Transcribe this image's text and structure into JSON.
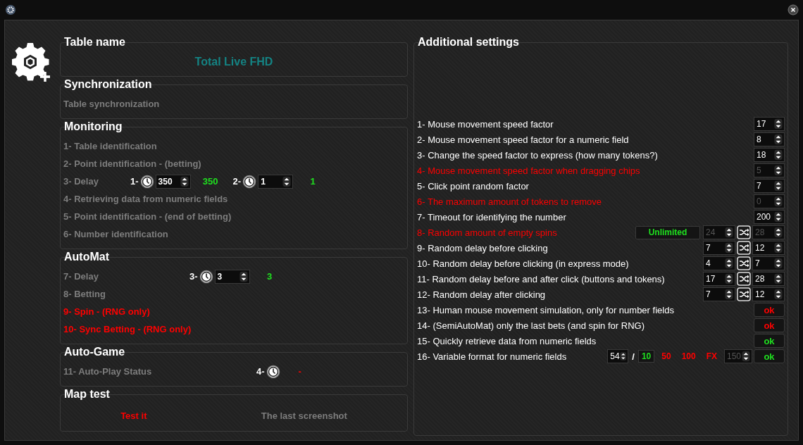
{
  "table_name": {
    "title": "Table name",
    "value": "Total Live FHD"
  },
  "synchronization": {
    "title": "Synchronization",
    "items": [
      {
        "label": "Table synchronization",
        "alert": false
      }
    ]
  },
  "monitoring": {
    "title": "Monitoring",
    "items": [
      {
        "label": "1- Table identification",
        "alert": false
      },
      {
        "label": "2- Point identification - (betting)",
        "alert": false
      },
      {
        "label": "3- Delay",
        "alert": false,
        "timers": [
          {
            "label": "1-",
            "value": "350",
            "reading": "350",
            "alert": false
          },
          {
            "label": "2-",
            "value": "1",
            "reading": "1",
            "alert": false
          }
        ]
      },
      {
        "label": "4- Retrieving data from numeric fields",
        "alert": false
      },
      {
        "label": "5- Point identification - (end of betting)",
        "alert": false
      },
      {
        "label": "6- Number identification",
        "alert": false
      }
    ]
  },
  "automat": {
    "title": "AutoMat",
    "items": [
      {
        "label": "7- Delay",
        "alert": false,
        "timers": [
          {
            "label": "3-",
            "value": "3",
            "reading": "3",
            "alert": false
          }
        ]
      },
      {
        "label": "8- Betting",
        "alert": false
      },
      {
        "label": "9- Spin - (RNG only)",
        "alert": true
      },
      {
        "label": "10- Sync Betting - (RNG only)",
        "alert": true
      }
    ]
  },
  "auto_game": {
    "title": "Auto-Game",
    "items": [
      {
        "label": "11- Auto-Play Status",
        "alert": false,
        "timers": [
          {
            "label": "4-",
            "reading": "-",
            "alert": true
          }
        ]
      }
    ]
  },
  "map_test": {
    "title": "Map test",
    "links": [
      {
        "label": "Test it",
        "alert": true
      },
      {
        "label": "The last screenshot",
        "alert": false
      }
    ]
  },
  "additional_settings": {
    "title": "Additional settings",
    "rows": [
      {
        "kind": "spin",
        "label": "1- Mouse movement speed factor",
        "alert": false,
        "value": "17",
        "disabled": false
      },
      {
        "kind": "spin",
        "label": "2- Mouse movement speed factor for a numeric field",
        "alert": false,
        "value": "8",
        "disabled": false
      },
      {
        "kind": "spin",
        "label": "3- Change the speed factor to express (how many tokens?)",
        "alert": false,
        "value": "18",
        "disabled": false
      },
      {
        "kind": "spin",
        "label": "4- Mouse movement speed factor when dragging chips",
        "alert": true,
        "value": "5",
        "disabled": true
      },
      {
        "kind": "spin",
        "label": "5- Click point random factor",
        "alert": false,
        "value": "7",
        "disabled": false
      },
      {
        "kind": "spin",
        "label": "6- The maximum amount of tokens to remove",
        "alert": true,
        "value": "0",
        "disabled": true
      },
      {
        "kind": "spin",
        "label": "7- Timeout for identifying the number",
        "alert": false,
        "value": "200",
        "disabled": false
      },
      {
        "kind": "range",
        "label": "8- Random amount of empty spins",
        "alert": true,
        "button": "Unlimited",
        "min": "24",
        "max": "28",
        "disabled": true
      },
      {
        "kind": "range",
        "label": "9- Random delay before clicking",
        "alert": false,
        "min": "7",
        "max": "12",
        "disabled": false
      },
      {
        "kind": "range",
        "label": "10- Random delay before clicking (in express mode)",
        "alert": false,
        "min": "4",
        "max": "7",
        "disabled": false
      },
      {
        "kind": "range",
        "label": "11- Random delay before and after click (buttons and tokens)",
        "alert": false,
        "min": "17",
        "max": "28",
        "disabled": false
      },
      {
        "kind": "range",
        "label": "12- Random delay after clicking",
        "alert": false,
        "min": "7",
        "max": "12",
        "disabled": false
      },
      {
        "kind": "toggle",
        "label": "13- Human mouse movement simulation, only for number fields",
        "alert": false,
        "button": "ok",
        "on": false
      },
      {
        "kind": "toggle",
        "label": "14- (SemiAutoMat) only the last bets (and spin for RNG)",
        "alert": false,
        "button": "ok",
        "on": false
      },
      {
        "kind": "toggle",
        "label": "15- Quickly retrieve data from numeric fields",
        "alert": false,
        "button": "ok",
        "on": true
      },
      {
        "kind": "format",
        "label": "16- Variable format for numeric fields",
        "alert": false,
        "value": "54",
        "separator": "/",
        "options": [
          {
            "label": "10",
            "selected": true
          },
          {
            "label": "50",
            "selected": false
          },
          {
            "label": "100",
            "selected": false
          },
          {
            "label": "FX",
            "selected": false
          }
        ],
        "custom": "150",
        "custom_disabled": true,
        "button": "ok",
        "on": true
      }
    ]
  }
}
